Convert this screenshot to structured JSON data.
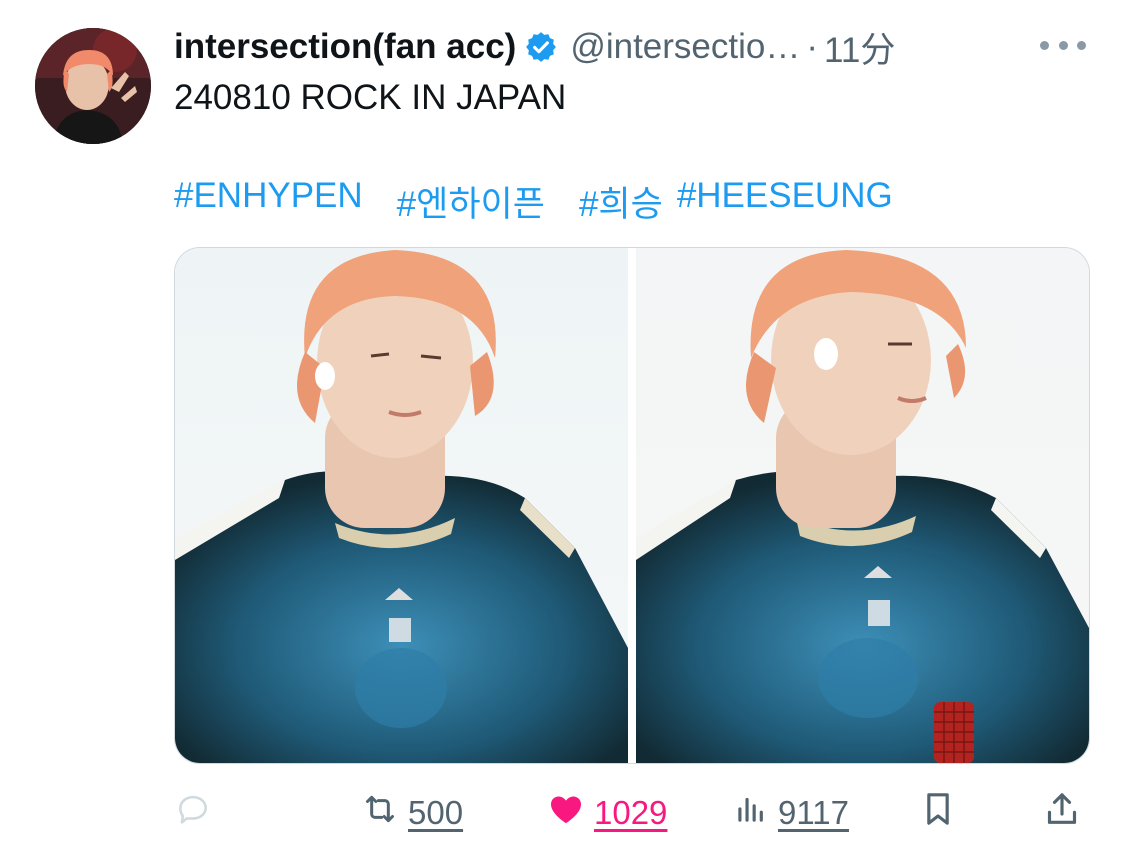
{
  "post": {
    "display_name": "intersection(fan acc)",
    "handle": "@intersectio…",
    "separator": "·",
    "time": "11分",
    "text": "240810 ROCK IN JAPAN",
    "hashtags": [
      "#ENHYPEN",
      "#엔하이픈",
      "#희승",
      "#HEESEUNG"
    ]
  },
  "media": {
    "count": 2
  },
  "actions": {
    "reply_count": "",
    "repost_count": "500",
    "like_count": "1029",
    "view_count": "9117"
  },
  "colors": {
    "link": "#1d9bf0",
    "like": "#f91880",
    "muted": "#536471",
    "verified": "#1d9bf0"
  },
  "icons": {
    "verified": "verified-badge-icon",
    "more": "more-icon",
    "reply": "reply-icon",
    "repost": "repost-icon",
    "like": "heart-icon",
    "views": "views-icon",
    "bookmark": "bookmark-icon",
    "share": "share-icon"
  }
}
